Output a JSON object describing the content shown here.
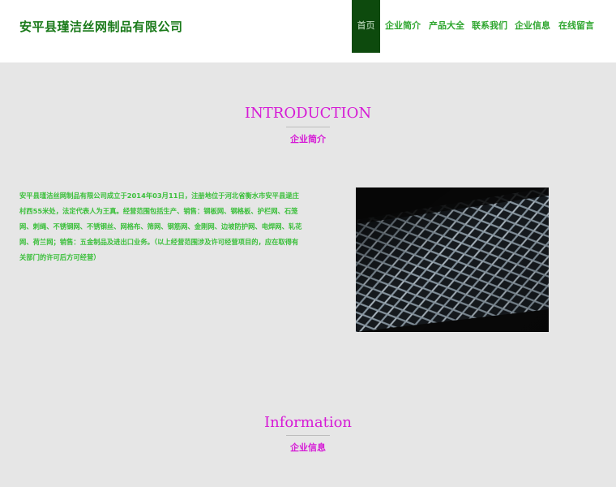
{
  "header": {
    "company_name": "安平县瑾洁丝网制品有限公司",
    "nav": [
      "首页",
      "企业简介",
      "产品大全",
      "联系我们",
      "企业信息",
      "在线留言"
    ]
  },
  "intro": {
    "title": "INTRODUCTION",
    "subtitle": "企业简介",
    "body": "安平县瑾洁丝网制品有限公司成立于2014年03月11日，注册地位于河北省衡水市安平县逯庄村西55米处，法定代表人为王真。经营范围包括生产、销售：钢板网、钢格板、护栏网、石笼网、刺绳、不锈钢网、不锈钢丝、网格布、筛网、钢筋网、金刚网、边坡防护网、电焊网、轧花网、荷兰网；销售：五金制品及进出口业务。（以上经营范围涉及许可经营项目的，应在取得有关部门的许可后方可经营）",
    "image": "expanded-metal-mesh-photo"
  },
  "info": {
    "title": "Information",
    "subtitle": "企业信息"
  },
  "colors": {
    "accent_magenta": "#d61ad6",
    "brand_green": "#1a7a1a",
    "nav_green": "#2fa62f",
    "nav_active_bg": "#0d4a0d",
    "page_bg": "#e6e6e6"
  }
}
